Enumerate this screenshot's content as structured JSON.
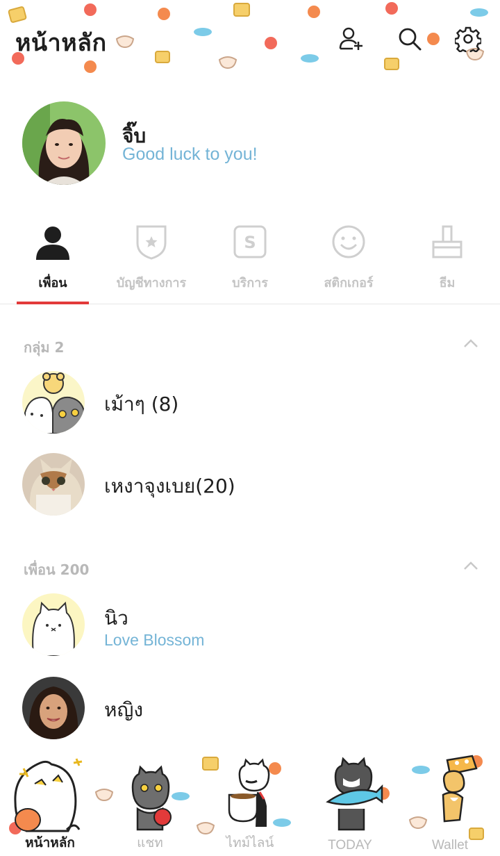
{
  "header": {
    "title": "หน้าหลัก",
    "add_friend_icon": "add-friend-icon",
    "search_icon": "search-icon",
    "settings_icon": "gear-icon"
  },
  "profile": {
    "name": "จิ๊บ",
    "status": "Good luck to you!"
  },
  "tabs": [
    {
      "label": "เพื่อน",
      "icon": "person-icon",
      "active": true
    },
    {
      "label": "บัญชีทางการ",
      "icon": "shield-star-icon",
      "active": false
    },
    {
      "label": "บริการ",
      "icon": "service-s-icon",
      "active": false
    },
    {
      "label": "สติกเกอร์",
      "icon": "smiley-icon",
      "active": false
    },
    {
      "label": "ธีม",
      "icon": "brush-icon",
      "active": false
    }
  ],
  "groups": {
    "header": "กลุ่ม 2",
    "items": [
      {
        "name": "เม้าๆ (8)"
      },
      {
        "name": "เหงาจุงเบย(20)"
      }
    ]
  },
  "friends": {
    "header": "เพื่อน 200",
    "items": [
      {
        "name": "นิว",
        "status": "Love Blossom"
      },
      {
        "name": "หญิง",
        "status": ""
      }
    ]
  },
  "bottom_nav": [
    {
      "label": "หน้าหลัก",
      "active": true
    },
    {
      "label": "แชท",
      "active": false
    },
    {
      "label": "ไทม์ไลน์",
      "active": false
    },
    {
      "label": "TODAY",
      "active": false
    },
    {
      "label": "Wallet",
      "active": false
    }
  ],
  "colors": {
    "accent": "#e23a3a",
    "status_text": "#74b4d6",
    "inactive": "#c4c4c4"
  }
}
